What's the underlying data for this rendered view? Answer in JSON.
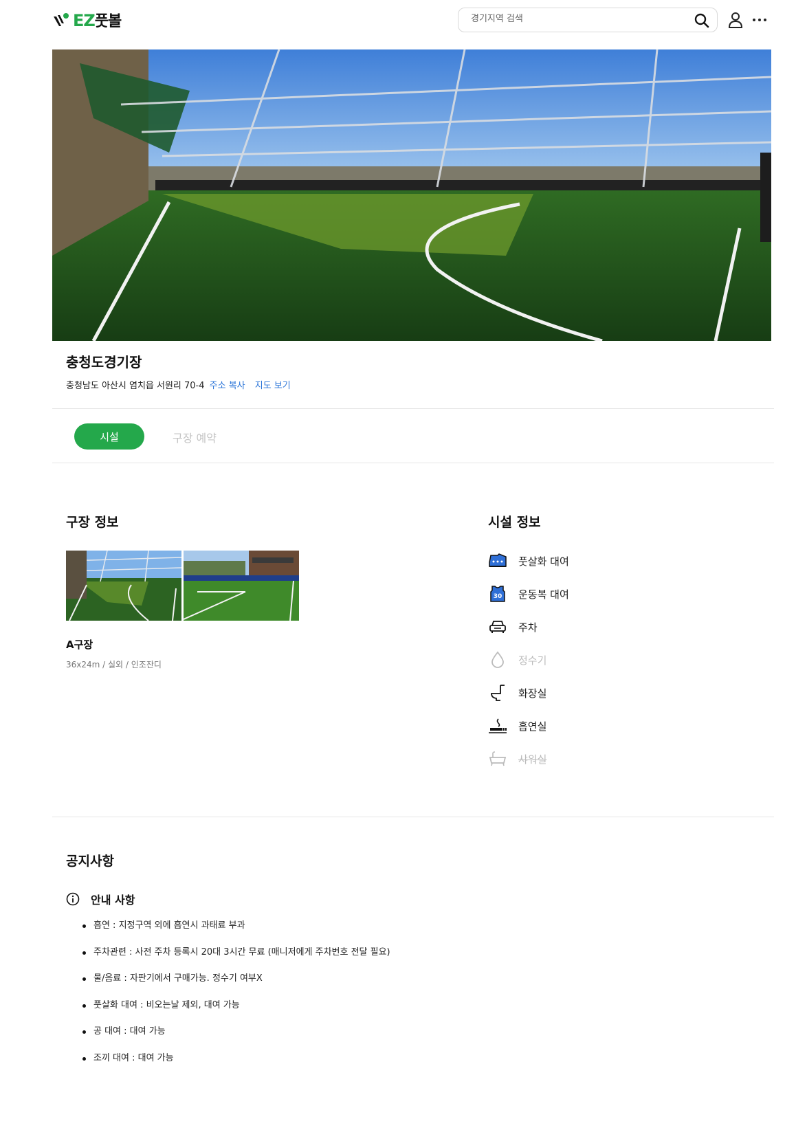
{
  "header": {
    "logo_text_en": "EZ",
    "logo_text_ko": "풋볼",
    "search_placeholder": "경기지역 검색"
  },
  "stadium": {
    "name": "충청도경기장",
    "address": "충청남도 아산시 염치읍 서원리 70-4",
    "copy_address_label": "주소 복사",
    "view_map_label": "지도 보기"
  },
  "tabs": [
    {
      "label": "시설",
      "active": true
    },
    {
      "label": "구장 예약",
      "active": false
    }
  ],
  "field_info": {
    "title": "구장 정보",
    "fields": [
      {
        "name": "A구장",
        "spec": "36x24m / 실외 / 인조잔디"
      }
    ]
  },
  "facility_info": {
    "title": "시설 정보",
    "items": [
      {
        "label": "풋살화 대여",
        "icon": "futsal-shoe-icon",
        "available": true
      },
      {
        "label": "운동복 대여",
        "icon": "jersey-icon",
        "available": true
      },
      {
        "label": "주차",
        "icon": "car-icon",
        "available": true
      },
      {
        "label": "정수기",
        "icon": "water-drop-icon",
        "available": false
      },
      {
        "label": "화장실",
        "icon": "toilet-icon",
        "available": true
      },
      {
        "label": "흡연실",
        "icon": "smoking-icon",
        "available": true
      },
      {
        "label": "샤워실",
        "icon": "bathtub-icon",
        "available": false
      }
    ]
  },
  "notice": {
    "title": "공지사항",
    "subtitle": "안내 사항",
    "items": [
      "흡연 : 지정구역 외에 흡연시 과태료 부과",
      "주차관련 : 사전 주차 등록시 20대 3시간 무료 (매니저에게 주차번호 전달 필요)",
      "물/음료 : 자판기에서 구매가능. 정수기 여부X",
      "풋살화 대여 : 비오는날 제외, 대여 가능",
      "공 대여 : 대여 가능",
      "조끼 대여 : 대여 가능"
    ]
  },
  "colors": {
    "brand_green": "#24a84b",
    "link_blue": "#2a74d8",
    "jersey_blue": "#2f6fd6"
  }
}
